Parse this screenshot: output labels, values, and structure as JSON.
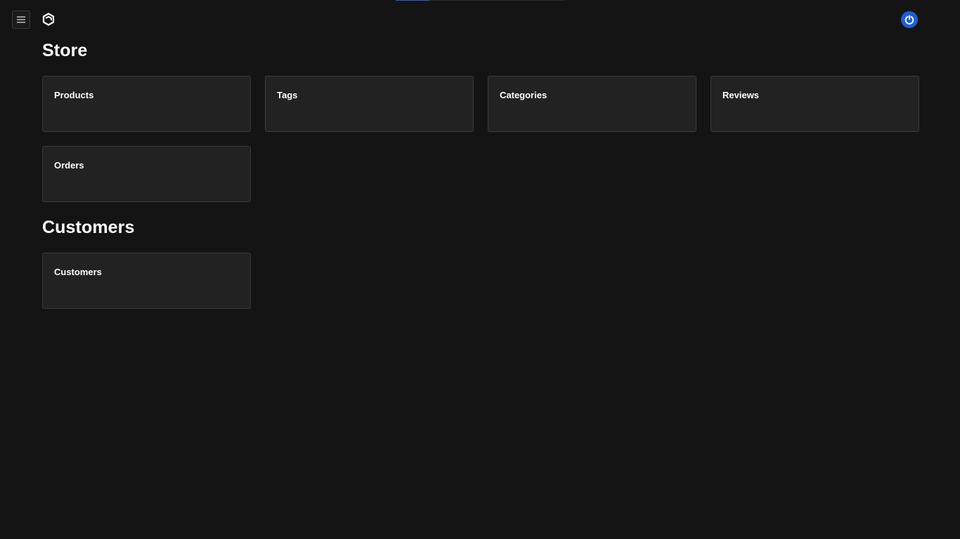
{
  "header": {
    "menu_icon": "hamburger-icon",
    "logo_icon": "hexagon-logo-icon",
    "user_icon": "power-icon",
    "accent_color": "#2563eb"
  },
  "top_progress": {
    "fraction": 0.2
  },
  "sections": [
    {
      "title": "Store",
      "cards": [
        {
          "label": "Products"
        },
        {
          "label": "Tags"
        },
        {
          "label": "Categories"
        },
        {
          "label": "Reviews"
        },
        {
          "label": "Orders"
        }
      ]
    },
    {
      "title": "Customers",
      "cards": [
        {
          "label": "Customers"
        }
      ]
    }
  ]
}
